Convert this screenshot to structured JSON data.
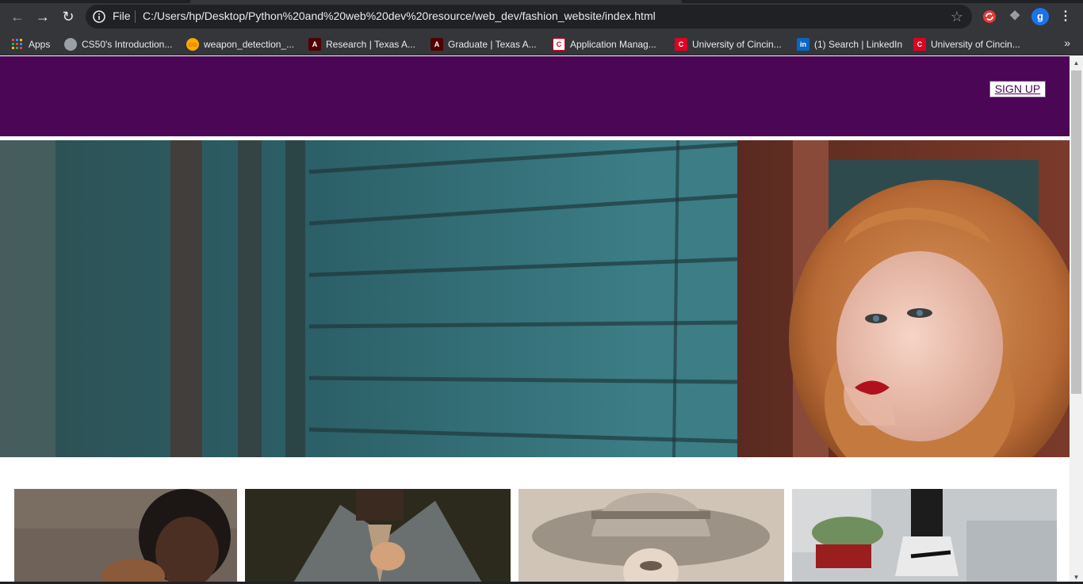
{
  "browser": {
    "address": {
      "scheme": "File",
      "url": "C:/Users/hp/Desktop/Python%20and%20web%20dev%20resource/web_dev/fashion_website/index.html"
    },
    "profile_initial": "g",
    "bookmarks": [
      {
        "label": "Apps",
        "icon": "apps-grid-icon"
      },
      {
        "label": "CS50's Introduction...",
        "icon": "globe-icon"
      },
      {
        "label": "weapon_detection_...",
        "icon": "colab-icon"
      },
      {
        "label": "Research | Texas A...",
        "icon": "tamu-icon"
      },
      {
        "label": "Graduate | Texas A...",
        "icon": "tamu-icon"
      },
      {
        "label": "Application Manag...",
        "icon": "uc-icon"
      },
      {
        "label": "University of Cincin...",
        "icon": "uc-icon"
      },
      {
        "label": "(1) Search | LinkedIn",
        "icon": "linkedin-icon"
      },
      {
        "label": "University of Cincin...",
        "icon": "uc-icon"
      }
    ],
    "more_bookmarks": "»"
  },
  "site": {
    "header": {
      "signup_label": "SIGN UP",
      "background": "#4b0656"
    }
  },
  "colors": {
    "chrome": "#35363a",
    "omnibox": "#202124",
    "brand_purple": "#4b0656"
  }
}
